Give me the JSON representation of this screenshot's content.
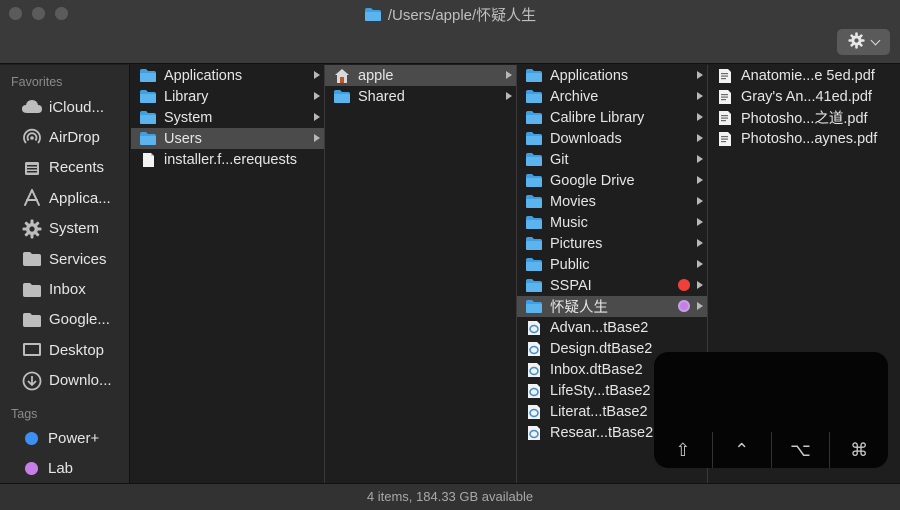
{
  "window": {
    "title": "/Users/apple/怀疑人生"
  },
  "toolbar": {
    "action_menu_icon": "gear-icon"
  },
  "sidebar": {
    "favorites_header": "Favorites",
    "favorites": [
      {
        "label": "iCloud...",
        "icon": "cloud-icon"
      },
      {
        "label": "AirDrop",
        "icon": "airdrop-icon"
      },
      {
        "label": "Recents",
        "icon": "recents-icon"
      },
      {
        "label": "Applica...",
        "icon": "applications-icon"
      },
      {
        "label": "System",
        "icon": "gear-icon"
      },
      {
        "label": "Services",
        "icon": "folder-icon"
      },
      {
        "label": "Inbox",
        "icon": "folder-icon"
      },
      {
        "label": "Google...",
        "icon": "folder-icon"
      },
      {
        "label": "Desktop",
        "icon": "desktop-icon"
      },
      {
        "label": "Downlo...",
        "icon": "download-icon"
      }
    ],
    "tags_header": "Tags",
    "tags": [
      {
        "label": "Power+",
        "color": "#3b8ff5"
      },
      {
        "label": "Lab",
        "color": "#c77ee8"
      }
    ]
  },
  "columns": [
    {
      "items": [
        {
          "label": "Applications",
          "icon": "folder-icon",
          "arrow": true
        },
        {
          "label": "Library",
          "icon": "folder-icon",
          "arrow": true
        },
        {
          "label": "System",
          "icon": "folder-icon",
          "arrow": true
        },
        {
          "label": "Users",
          "icon": "folder-icon",
          "arrow": true,
          "selected": true
        },
        {
          "label": "installer.f...erequests",
          "icon": "document-icon",
          "arrow": false
        }
      ]
    },
    {
      "items": [
        {
          "label": "apple",
          "icon": "home-icon",
          "arrow": true,
          "selected": true
        },
        {
          "label": "Shared",
          "icon": "folder-icon",
          "arrow": true
        }
      ]
    },
    {
      "items": [
        {
          "label": "Applications",
          "icon": "folder-icon",
          "arrow": true
        },
        {
          "label": "Archive",
          "icon": "folder-icon",
          "arrow": true
        },
        {
          "label": "Calibre Library",
          "icon": "folder-icon",
          "arrow": true
        },
        {
          "label": "Downloads",
          "icon": "folder-icon",
          "arrow": true
        },
        {
          "label": "Git",
          "icon": "folder-icon",
          "arrow": true
        },
        {
          "label": "Google Drive",
          "icon": "folder-icon",
          "arrow": true
        },
        {
          "label": "Movies",
          "icon": "folder-icon",
          "arrow": true
        },
        {
          "label": "Music",
          "icon": "folder-icon",
          "arrow": true
        },
        {
          "label": "Pictures",
          "icon": "folder-icon",
          "arrow": true
        },
        {
          "label": "Public",
          "icon": "folder-icon",
          "arrow": true
        },
        {
          "label": "SSPAI",
          "icon": "folder-icon",
          "arrow": true,
          "tag_color": "#f0403a"
        },
        {
          "label": "怀疑人生",
          "icon": "folder-icon",
          "arrow": true,
          "selected": true,
          "tag_color": "#c77ee8"
        },
        {
          "label": "Advan...tBase2",
          "icon": "database-icon",
          "arrow": false
        },
        {
          "label": "Design.dtBase2",
          "icon": "database-icon",
          "arrow": false
        },
        {
          "label": "Inbox.dtBase2",
          "icon": "database-icon",
          "arrow": false
        },
        {
          "label": "LifeSty...tBase2",
          "icon": "database-icon",
          "arrow": false
        },
        {
          "label": "Literat...tBase2",
          "icon": "database-icon",
          "arrow": false
        },
        {
          "label": "Resear...tBase2",
          "icon": "database-icon",
          "arrow": false
        }
      ]
    },
    {
      "items": [
        {
          "label": "Anatomie...e 5ed.pdf",
          "icon": "pdf-icon",
          "arrow": false
        },
        {
          "label": "Gray's An...41ed.pdf",
          "icon": "pdf-icon",
          "arrow": false
        },
        {
          "label": "Photosho...之道.pdf",
          "icon": "pdf-icon",
          "arrow": false
        },
        {
          "label": "Photosho...aynes.pdf",
          "icon": "pdf-icon",
          "arrow": false
        }
      ]
    }
  ],
  "touchbar": {
    "keys": [
      {
        "label": "⇧",
        "icon": "shift-icon"
      },
      {
        "label": "⌃",
        "icon": "control-icon"
      },
      {
        "label": "⌥",
        "icon": "option-icon"
      },
      {
        "label": "⌘",
        "icon": "command-icon"
      }
    ]
  },
  "status": {
    "text": "4 items, 184.33 GB available"
  },
  "colors": {
    "folder": "#3f9fe0",
    "selection": "#4b4b4b",
    "background": "#1e1e1e"
  }
}
